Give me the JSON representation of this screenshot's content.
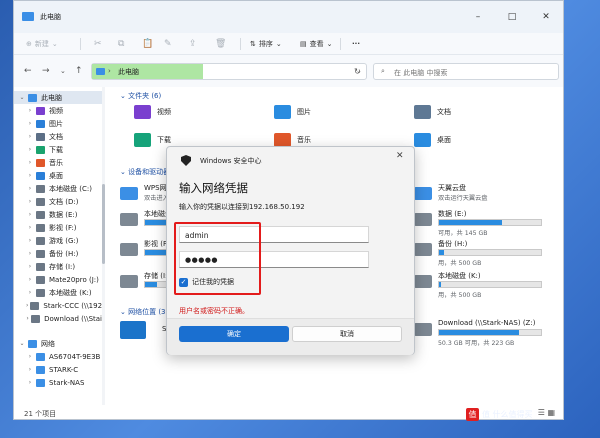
{
  "window": {
    "title": "此电脑"
  },
  "toolbar": {
    "new_label": "新建",
    "sort_label": "排序",
    "view_label": "查看",
    "more_label": "···"
  },
  "address": {
    "path": "此电脑",
    "search_placeholder": "在 此电脑 中搜索"
  },
  "sidebar": {
    "items": [
      {
        "label": "此电脑",
        "icon": "pc-icon",
        "selected": true,
        "expanded": true,
        "color": "#3b8fe5"
      },
      {
        "label": "视频",
        "icon": "video-icon",
        "color": "#7a3fcf"
      },
      {
        "label": "图片",
        "icon": "picture-icon",
        "color": "#2a7fd8"
      },
      {
        "label": "文档",
        "icon": "document-icon",
        "color": "#5c6f86"
      },
      {
        "label": "下载",
        "icon": "download-icon",
        "color": "#1aa36e"
      },
      {
        "label": "音乐",
        "icon": "music-icon",
        "color": "#e0572a"
      },
      {
        "label": "桌面",
        "icon": "desktop-icon",
        "color": "#2a7fd8"
      },
      {
        "label": "本地磁盘 (C:)",
        "icon": "drive-icon",
        "color": "#6b7785"
      },
      {
        "label": "文档 (D:)",
        "icon": "drive-icon",
        "color": "#6b7785"
      },
      {
        "label": "数据 (E:)",
        "icon": "drive-icon",
        "color": "#6b7785"
      },
      {
        "label": "影视 (F:)",
        "icon": "drive-icon",
        "color": "#6b7785"
      },
      {
        "label": "游戏 (G:)",
        "icon": "drive-icon",
        "color": "#6b7785"
      },
      {
        "label": "备份 (H:)",
        "icon": "drive-icon",
        "color": "#6b7785"
      },
      {
        "label": "存储 (I:)",
        "icon": "drive-icon",
        "color": "#6b7785"
      },
      {
        "label": "Mate20pro (J:)",
        "icon": "phone-icon",
        "color": "#6b7785"
      },
      {
        "label": "本地磁盘 (K:)",
        "icon": "drive-icon",
        "color": "#6b7785"
      },
      {
        "label": "Stark-CCC (\\\\192",
        "icon": "network-drive-icon",
        "color": "#6b7785"
      },
      {
        "label": "Download (\\\\Stai",
        "icon": "network-drive-icon",
        "color": "#6b7785"
      },
      {
        "label": "网络",
        "icon": "network-icon",
        "expanded": true,
        "color": "#3b8fe5"
      },
      {
        "label": "AS6704T-9E3B",
        "icon": "computer-icon",
        "color": "#3b8fe5"
      },
      {
        "label": "STARK-C",
        "icon": "computer-icon",
        "color": "#3b8fe5"
      },
      {
        "label": "Stark-NAS",
        "icon": "computer-icon",
        "color": "#3b8fe5"
      }
    ]
  },
  "content": {
    "groups": {
      "folders": "文件夹 (6)",
      "devices": "设备和驱动器 (11)",
      "network": "网络位置 (3)"
    },
    "folders": [
      {
        "label": "视频",
        "color": "#7a3fcf"
      },
      {
        "label": "图片",
        "color": "#2a8ce0"
      },
      {
        "label": "文档",
        "color": "#5e7894"
      },
      {
        "label": "下载",
        "color": "#16a37a"
      },
      {
        "label": "音乐",
        "color": "#e0572a"
      },
      {
        "label": "桌面",
        "color": "#2a8ce0"
      }
    ],
    "drives_left": [
      {
        "name": "WPS网盘",
        "info": "双击进入WPS网盘",
        "nobar": true
      },
      {
        "name": "本地磁盘",
        "fill": 0.55,
        "info": ""
      },
      {
        "name": "影视 (F:)",
        "fill": 0.62,
        "info": ""
      },
      {
        "name": "存储 (I:)",
        "fill": 0.12,
        "info": ""
      }
    ],
    "drives_right": [
      {
        "name": "天翼云盘",
        "info": "双击运行天翼云盘",
        "nobar": true
      },
      {
        "name": "数据 (E:)",
        "fill": 0.62,
        "info": ""
      },
      {
        "name": "备份 (H:)",
        "fill": 0.05,
        "info": "",
        "mid": "用，共 500 GB"
      },
      {
        "name": "本地磁盘 (K:)",
        "fill": 0.02,
        "info": "",
        "mid": "用，共 500 GB"
      }
    ],
    "drive_infos": {
      "e": "可用，共 145 GB",
      "h": "用，共 500 GB",
      "k": "用，共 500 GB"
    },
    "network": [
      {
        "name": "Stark",
        "side": "left"
      },
      {
        "name": "Download (\\\\Stark-NAS) (Z:)",
        "info": "50.3 GB 可用，共 223 GB",
        "fill": 0.78
      }
    ]
  },
  "status": {
    "count": "21 个项目"
  },
  "dialog": {
    "title": "Windows 安全中心",
    "heading": "输入网络凭据",
    "subtitle": "输入你的凭据以连接到192.168.50.192",
    "username": "admin",
    "password": "●●●●●",
    "remember_label": "记住我的凭据",
    "error": "用户名或密码不正确。",
    "ok_label": "确定",
    "cancel_label": "取消"
  },
  "watermark": {
    "text": "值 什么值得买",
    "badge": "值"
  }
}
